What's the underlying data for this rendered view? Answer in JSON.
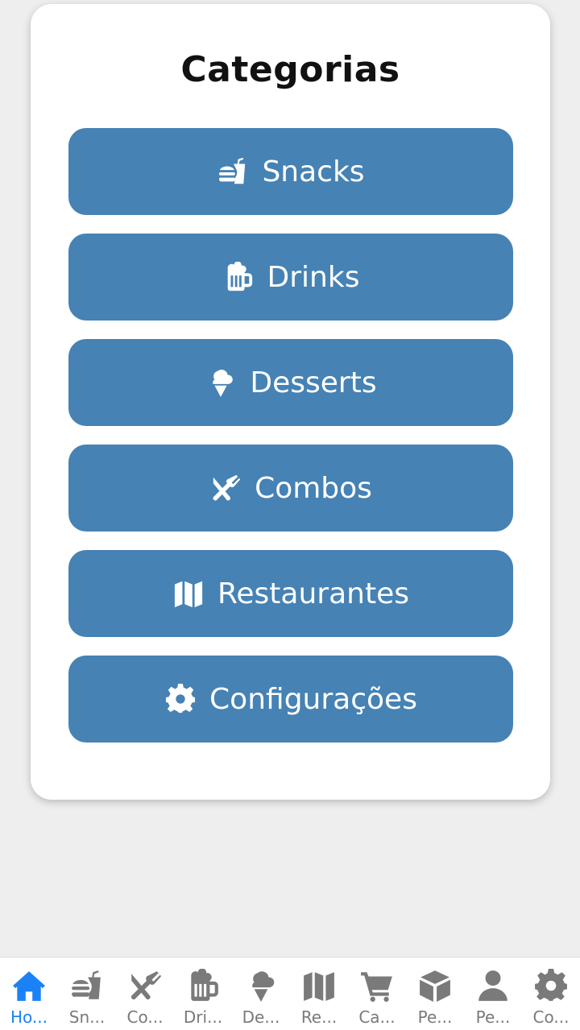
{
  "card": {
    "title": "Categorias",
    "buttons": [
      {
        "label": "Snacks",
        "icon": "burger-soda-icon"
      },
      {
        "label": "Drinks",
        "icon": "beer-mug-icon"
      },
      {
        "label": "Desserts",
        "icon": "ice-cream-icon"
      },
      {
        "label": "Combos",
        "icon": "utensils-icon"
      },
      {
        "label": "Restaurantes",
        "icon": "map-icon"
      },
      {
        "label": "Configurações",
        "icon": "gear-icon"
      }
    ]
  },
  "tabbar": {
    "active_color": "#1a82f6",
    "inactive_color": "#7a7a7a",
    "tabs": [
      {
        "label": "Ho...",
        "icon": "home-icon",
        "active": true
      },
      {
        "label": "Sn...",
        "icon": "burger-soda-icon"
      },
      {
        "label": "Co...",
        "icon": "utensils-icon"
      },
      {
        "label": "Dri...",
        "icon": "beer-mug-icon"
      },
      {
        "label": "De...",
        "icon": "ice-cream-icon"
      },
      {
        "label": "Re...",
        "icon": "map-icon"
      },
      {
        "label": "Ca...",
        "icon": "cart-icon"
      },
      {
        "label": "Pe...",
        "icon": "box-icon"
      },
      {
        "label": "Pe...",
        "icon": "user-icon"
      },
      {
        "label": "Co...",
        "icon": "gear-icon"
      }
    ]
  },
  "colors": {
    "button_bg": "#4682b4",
    "page_bg": "#eeeeee"
  }
}
